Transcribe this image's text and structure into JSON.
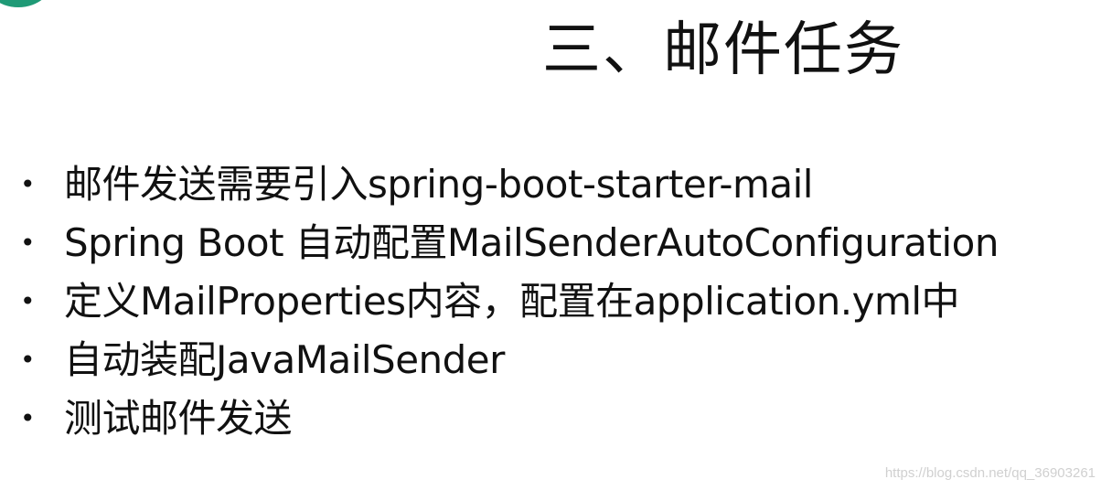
{
  "title": "三、邮件任务",
  "bullet_symbol": "•",
  "bullets": [
    "邮件发送需要引入spring-boot-starter-mail",
    "Spring Boot 自动配置MailSenderAutoConfiguration",
    "定义MailProperties内容，配置在application.yml中",
    "自动装配JavaMailSender",
    "测试邮件发送"
  ],
  "watermark": "https://blog.csdn.net/qq_36903261",
  "colors": {
    "accent": "#1f9a76",
    "text": "#111111",
    "background": "#ffffff",
    "watermark": "#d0d0d0"
  }
}
